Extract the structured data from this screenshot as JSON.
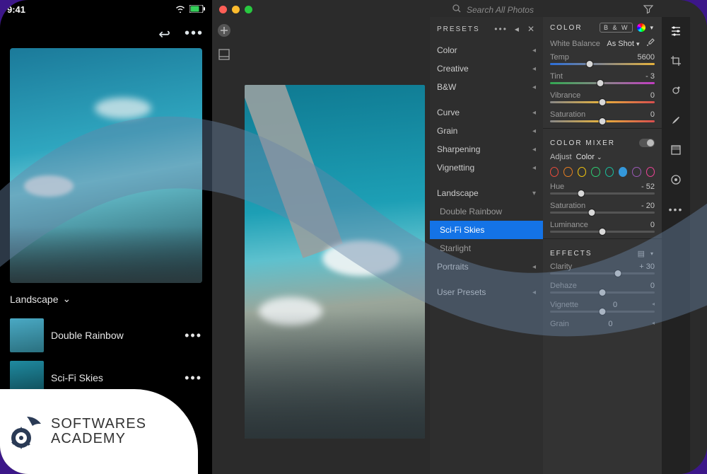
{
  "mobile": {
    "time": "9:41",
    "category": "Landscape",
    "items": [
      {
        "label": "Double Rainbow"
      },
      {
        "label": "Sci-Fi Skies"
      }
    ]
  },
  "desktop": {
    "search_placeholder": "Search All Photos"
  },
  "presets": {
    "title": "PRESETS",
    "groups": [
      "Color",
      "Creative",
      "B&W",
      "Curve",
      "Grain",
      "Sharpening",
      "Vignetting"
    ],
    "landscape": {
      "label": "Landscape",
      "items": [
        "Double Rainbow",
        "Sci-Fi Skies",
        "Starlight"
      ]
    },
    "portraits": "Portraits",
    "user": "User Presets"
  },
  "color": {
    "title": "COLOR",
    "bw": "B & W",
    "wb_label": "White Balance",
    "wb_value": "As Shot",
    "temp_label": "Temp",
    "temp_value": "5600",
    "tint_label": "Tint",
    "tint_value": "- 3",
    "vibrance_label": "Vibrance",
    "vibrance_value": "0",
    "saturation_label": "Saturation",
    "saturation_value": "0"
  },
  "mixer": {
    "title": "COLOR MIXER",
    "adjust_label": "Adjust",
    "adjust_value": "Color",
    "hue_label": "Hue",
    "hue_value": "- 52",
    "sat_label": "Saturation",
    "sat_value": "- 20",
    "lum_label": "Luminance",
    "lum_value": "0"
  },
  "effects": {
    "title": "EFFECTS",
    "clarity_label": "Clarity",
    "clarity_value": "+ 30",
    "dehaze_label": "Dehaze",
    "dehaze_value": "0",
    "vignette_label": "Vignette",
    "vignette_value": "0",
    "grain_label": "Grain",
    "grain_value": "0"
  },
  "watermark": {
    "line1": "SOFTWARES",
    "line2": "ACADEMY"
  }
}
